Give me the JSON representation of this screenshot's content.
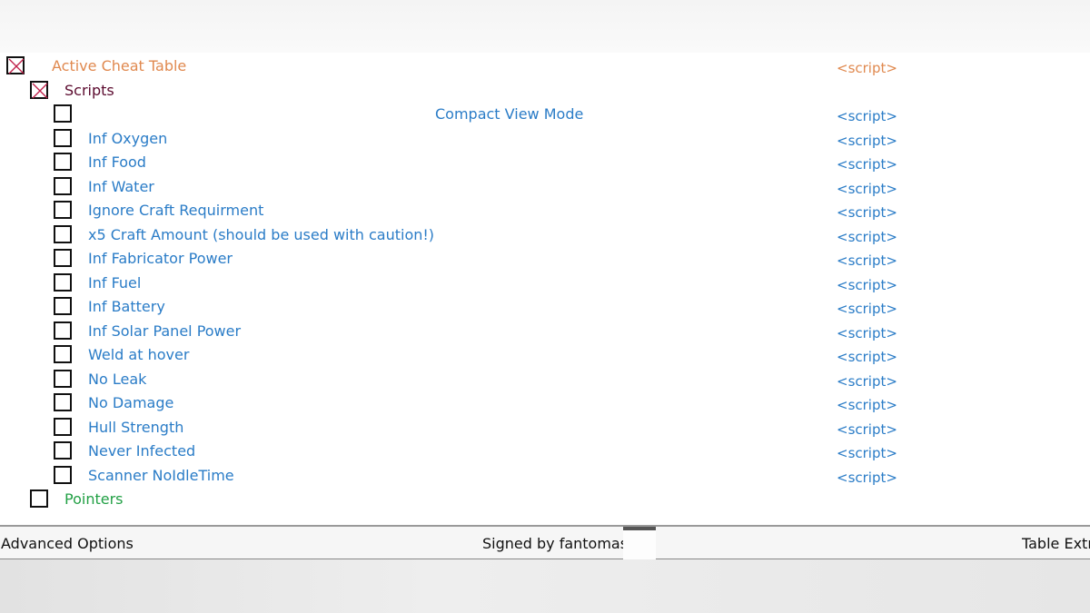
{
  "colors": {
    "header": "#e0894f",
    "group": "#5b0a2e",
    "script": "#2a7cc7",
    "pointers": "#22a045"
  },
  "tree": [
    {
      "label": "Active Cheat Table",
      "value": "<script>",
      "level": 0,
      "checked": true,
      "color": "header"
    },
    {
      "label": "Scripts",
      "value": "",
      "level": 1,
      "checked": true,
      "color": "group"
    },
    {
      "label": "Compact View Mode",
      "value": "<script>",
      "level": 2,
      "checked": false,
      "color": "script",
      "center": true
    },
    {
      "label": "Inf Oxygen",
      "value": "<script>",
      "level": 2,
      "checked": false,
      "color": "script"
    },
    {
      "label": "Inf Food",
      "value": "<script>",
      "level": 2,
      "checked": false,
      "color": "script"
    },
    {
      "label": "Inf Water",
      "value": "<script>",
      "level": 2,
      "checked": false,
      "color": "script"
    },
    {
      "label": "Ignore Craft Requirment",
      "value": "<script>",
      "level": 2,
      "checked": false,
      "color": "script"
    },
    {
      "label": "x5 Craft Amount (should be used with caution!)",
      "value": "<script>",
      "level": 2,
      "checked": false,
      "color": "script"
    },
    {
      "label": "Inf Fabricator Power",
      "value": "<script>",
      "level": 2,
      "checked": false,
      "color": "script"
    },
    {
      "label": "Inf Fuel",
      "value": "<script>",
      "level": 2,
      "checked": false,
      "color": "script"
    },
    {
      "label": "Inf Battery",
      "value": "<script>",
      "level": 2,
      "checked": false,
      "color": "script"
    },
    {
      "label": "Inf Solar Panel Power",
      "value": "<script>",
      "level": 2,
      "checked": false,
      "color": "script"
    },
    {
      "label": "Weld at hover",
      "value": "<script>",
      "level": 2,
      "checked": false,
      "color": "script"
    },
    {
      "label": "No Leak",
      "value": "<script>",
      "level": 2,
      "checked": false,
      "color": "script"
    },
    {
      "label": "No Damage",
      "value": "<script>",
      "level": 2,
      "checked": false,
      "color": "script"
    },
    {
      "label": "Hull Strength",
      "value": "<script>",
      "level": 2,
      "checked": false,
      "color": "script"
    },
    {
      "label": "Never Infected",
      "value": "<script>",
      "level": 2,
      "checked": false,
      "color": "script"
    },
    {
      "label": "Scanner NoIdleTime",
      "value": "<script>",
      "level": 2,
      "checked": false,
      "color": "script"
    },
    {
      "label": "Pointers",
      "value": "",
      "level": 1,
      "checked": false,
      "color": "pointers"
    }
  ],
  "statusbar": {
    "advanced": "Advanced Options",
    "signed": "Signed by fantomas",
    "extras": "Table Extr"
  }
}
